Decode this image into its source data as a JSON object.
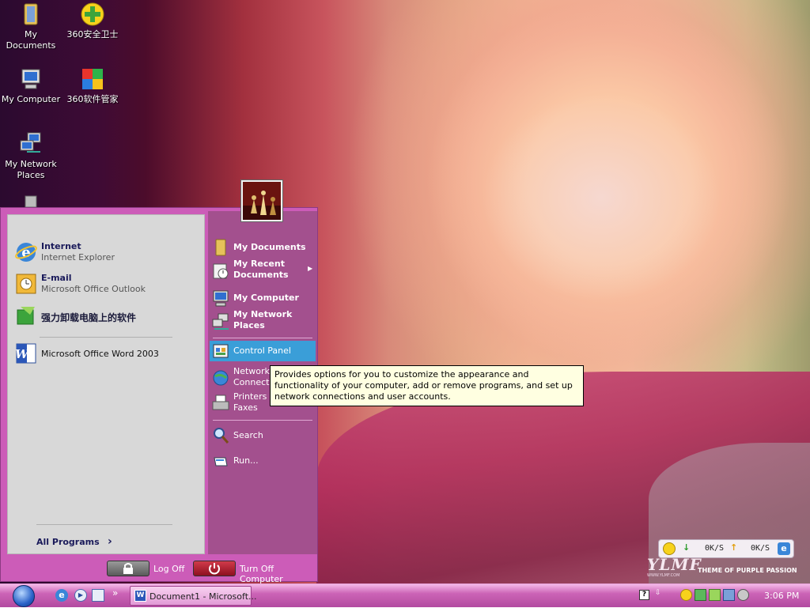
{
  "desktop": {
    "icons": [
      {
        "label": "My Documents",
        "icon": "my-documents-icon"
      },
      {
        "label": "360安全卫士",
        "icon": "360-safe-icon"
      },
      {
        "label": "My Computer",
        "icon": "my-computer-icon"
      },
      {
        "label": "360软件管家",
        "icon": "360-software-manager-icon"
      },
      {
        "label_line1": "My Network",
        "label_line2": "Places",
        "icon": "network-places-icon"
      },
      {
        "label": "",
        "icon": "recycle-bin-icon"
      }
    ]
  },
  "start_menu": {
    "pinned": [
      {
        "title": "Internet",
        "subtitle": "Internet Explorer",
        "icon": "internet-explorer-icon"
      },
      {
        "title": "E-mail",
        "subtitle": "Microsoft Office Outlook",
        "icon": "outlook-icon"
      },
      {
        "title": "强力卸载电脑上的软件",
        "icon": "uninstall-tool-icon"
      }
    ],
    "recent": [
      {
        "title": "Microsoft Office Word 2003",
        "icon": "word-icon"
      }
    ],
    "all_programs": "All Programs",
    "right_items": [
      {
        "label": "My Documents",
        "icon": "my-documents-icon"
      },
      {
        "label_line1": "My Recent",
        "label_line2": "Documents",
        "icon": "recent-documents-icon"
      },
      {
        "label": "My Computer",
        "icon": "my-computer-icon"
      },
      {
        "label_line1": "My Network",
        "label_line2": "Places",
        "icon": "network-places-icon"
      },
      {
        "label": "Control Panel",
        "icon": "control-panel-icon"
      },
      {
        "label_line1": "Network",
        "label_line2": "Connecti",
        "icon": "network-connections-icon"
      },
      {
        "label_line1": "Printers a",
        "label_line2": "Faxes",
        "icon": "printers-icon"
      },
      {
        "label": "Search",
        "icon": "search-icon"
      },
      {
        "label": "Run...",
        "icon": "run-icon"
      }
    ],
    "log_off": "Log Off",
    "turn_off": "Turn Off Computer"
  },
  "tooltip": {
    "text": "Provides options for you to customize the appearance and functionality of your computer, add or remove programs, and set up network connections and user accounts."
  },
  "taskbar": {
    "quick_launch": [
      "internet-explorer-icon",
      "media-player-icon",
      "show-desktop-icon"
    ],
    "overflow": "»",
    "task_button": "Document1 - Microsoft...",
    "clock": "3:06 PM"
  },
  "net_monitor": {
    "download": "0K/S",
    "upload": "0K/S"
  },
  "branding": {
    "logo": "YLMF",
    "url": "WWW.YLMF.COM",
    "tagline": "THEME OF PURPLE PASSION"
  },
  "colors": {
    "start_menu_bg": "#cc5cb8",
    "right_pane": "#a3508e",
    "highlight": "#3a9ed8",
    "tooltip_bg": "#ffffe1"
  }
}
